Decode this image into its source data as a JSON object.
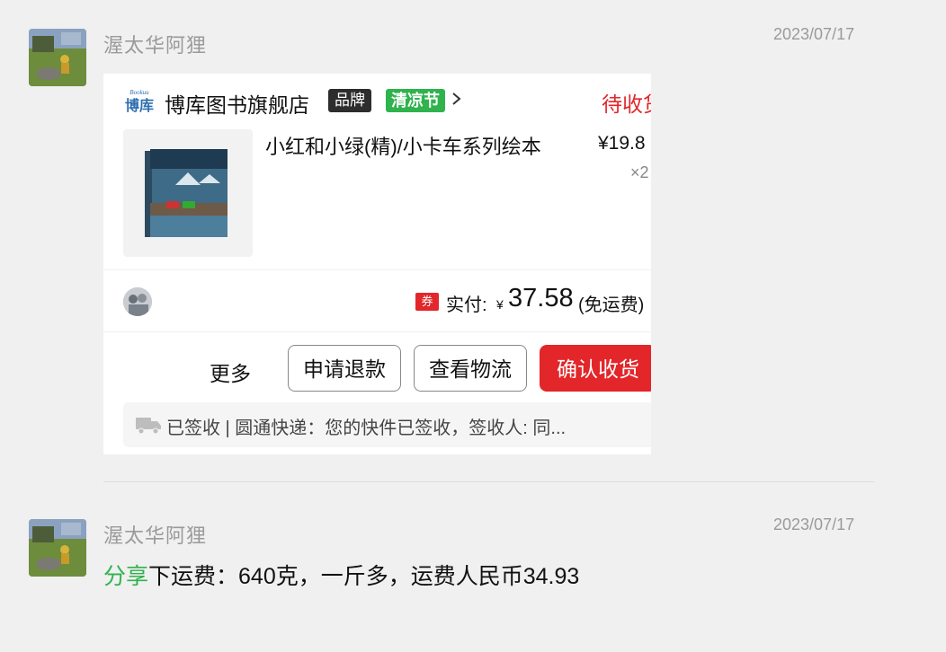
{
  "messages": [
    {
      "sender": "渥太华阿狸",
      "timestamp": "2023/07/17",
      "order_card": {
        "store_logo_text": "博库",
        "store_logo_brand": "Bookuu",
        "store_name": "博库图书旗舰店",
        "brand_tag": "品牌",
        "event_tag": "清凉节",
        "status": "待收货",
        "product_title": "小红和小绿(精)/小卡车系列绘本",
        "product_price": "¥19.8",
        "product_qty": "×2",
        "coupon_badge": "券",
        "paid_label": "实付:",
        "currency": "¥",
        "paid_amount": "37.58",
        "shipping_note": "(免运费)",
        "more_label": "更多",
        "refund_button": "申请退款",
        "logistics_button": "查看物流",
        "confirm_button": "确认收货",
        "tracking_text": "已签收 | 圆通快递：您的快件已签收，签收人: 同..."
      }
    },
    {
      "sender": "渥太华阿狸",
      "timestamp": "2023/07/17",
      "share_word": "分享",
      "text": "下运费：640克，一斤多，运费人民币34.93"
    }
  ],
  "colors": {
    "accent_red": "#e2262a",
    "accent_green": "#2fb34d",
    "background": "#f0f0f0"
  },
  "icons": [
    "avatar-photo",
    "store-logo",
    "chevron-right-icon",
    "coupon-icon",
    "truck-icon"
  ]
}
